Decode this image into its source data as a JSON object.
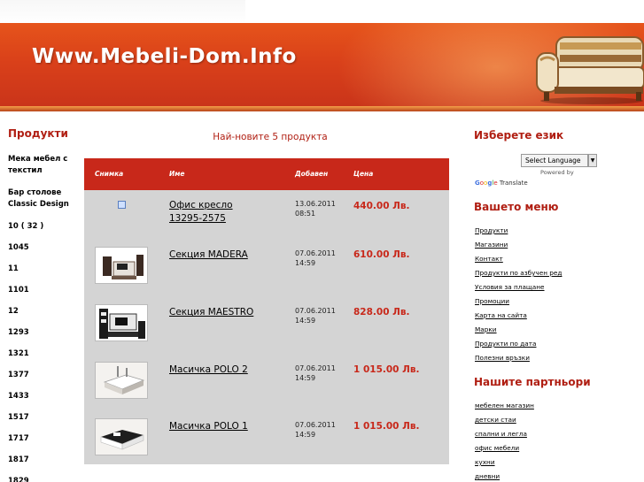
{
  "site": {
    "title": "Www.Mebeli-Dom.Info"
  },
  "left": {
    "heading": "Продукти",
    "items": [
      "Мека мебел с текстил",
      "Бар столове Classic Design",
      "10 ( 32 )",
      "1045",
      "11",
      "1101",
      "12",
      "1293",
      "1321",
      "1377",
      "1433",
      "1517",
      "1717",
      "1817",
      "1829"
    ]
  },
  "center": {
    "heading": "Най-новите 5 продукта",
    "columns": {
      "photo": "Снимка",
      "name": "Име",
      "added": "Добавен",
      "price": "Цена"
    },
    "products": [
      {
        "name": "Офис кресло 13295-2575",
        "date": "13.06.2011",
        "time": "08:51",
        "price": "440.00 Лв.",
        "image": "broken-image-icon"
      },
      {
        "name": "Секция MADERA",
        "date": "07.06.2011",
        "time": "14:59",
        "price": "610.00 Лв.",
        "image": "wall-unit-madera"
      },
      {
        "name": "Секция MAESTRO",
        "date": "07.06.2011",
        "time": "14:59",
        "price": "828.00 Лв.",
        "image": "wall-unit-maestro"
      },
      {
        "name": "Масичка POLO 2",
        "date": "07.06.2011",
        "time": "14:59",
        "price": "1 015.00 Лв.",
        "image": "coffee-table-polo-2"
      },
      {
        "name": "Масичка POLO 1",
        "date": "07.06.2011",
        "time": "14:59",
        "price": "1 015.00 Лв.",
        "image": "coffee-table-polo-1"
      }
    ]
  },
  "right": {
    "language_heading": "Изберете език",
    "language_select": "Select Language",
    "powered_by": "Powered by",
    "google": {
      "g": "G",
      "o1": "o",
      "o2": "o",
      "g2": "g",
      "l": "l",
      "e": "e",
      "translate": "Translate"
    },
    "menu_heading": "Вашето меню",
    "menu_items": [
      "Продукти",
      "Магазини",
      "Контакт",
      "Продукти по азбучен ред",
      "Условия за плащане",
      "Промоции",
      "Карта на сайта",
      "Марки",
      "Продукти по дата",
      "Полезни връзки"
    ],
    "partners_heading": "Нашите партньори",
    "partners": [
      "мебелен магазин",
      "детски стаи",
      "спални и легла",
      "офис мебели",
      "кухни",
      "дневни"
    ]
  },
  "colors": {
    "accent": "#c8281a",
    "heading": "#b01e12",
    "table_bg": "#d4d4d4"
  }
}
